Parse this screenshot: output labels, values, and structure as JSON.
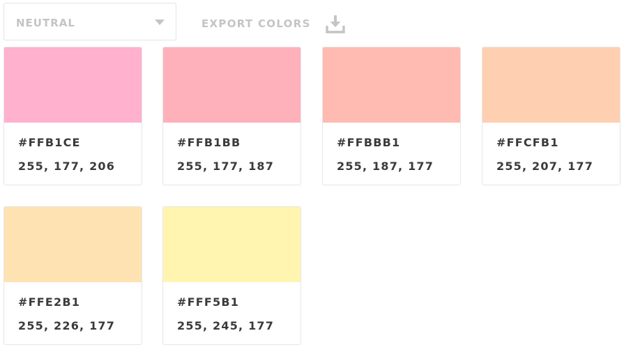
{
  "toolbar": {
    "palette_select": {
      "value": "NEUTRAL",
      "icon": "chevron-down-icon"
    },
    "export_button": {
      "label": "EXPORT COLORS",
      "icon": "download-icon"
    },
    "muted_color": "#c4c4c4"
  },
  "swatches": [
    {
      "hex": "#FFB1CE",
      "rgb": "255, 177, 206",
      "color": "#FFB1CE"
    },
    {
      "hex": "#FFB1BB",
      "rgb": "255, 177, 187",
      "color": "#FFB1BB"
    },
    {
      "hex": "#FFBBB1",
      "rgb": "255, 187, 177",
      "color": "#FFBBB1"
    },
    {
      "hex": "#FFCFB1",
      "rgb": "255, 207, 177",
      "color": "#FFCFB1"
    },
    {
      "hex": "#FFE2B1",
      "rgb": "255, 226, 177",
      "color": "#FFE2B1"
    },
    {
      "hex": "#FFF5B1",
      "rgb": "255, 245, 177",
      "color": "#FFF5B1"
    }
  ]
}
